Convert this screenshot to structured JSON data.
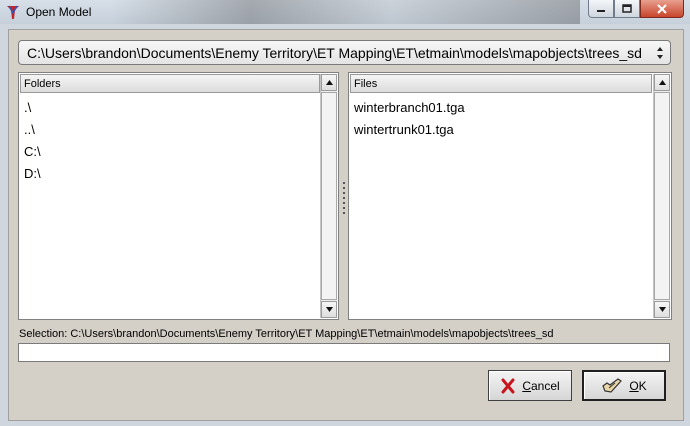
{
  "window": {
    "title": "Open Model"
  },
  "path_combo": {
    "value": "C:\\Users\\brandon\\Documents\\Enemy Territory\\ET Mapping\\ET\\etmain\\models\\mapobjects\\trees_sd"
  },
  "folders_pane": {
    "header": "Folders",
    "items": [
      ".\\",
      "..\\",
      "C:\\",
      "D:\\"
    ]
  },
  "files_pane": {
    "header": "Files",
    "items": [
      "winterbranch01.tga",
      "wintertrunk01.tga"
    ]
  },
  "selection": {
    "label": "Selection: C:\\Users\\brandon\\Documents\\Enemy Territory\\ET Mapping\\ET\\etmain\\models\\mapobjects\\trees_sd",
    "value": ""
  },
  "buttons": {
    "cancel_label_first": "C",
    "cancel_label_rest": "ancel",
    "ok_label_first": "O",
    "ok_label_rest": "K"
  },
  "icons": {
    "app": "radiant-app-icon",
    "minimize": "minimize-icon",
    "maximize": "maximize-icon",
    "close": "close-icon",
    "combo": "updown-arrows-icon",
    "cancel": "red-x-icon",
    "ok": "check-hand-icon"
  }
}
